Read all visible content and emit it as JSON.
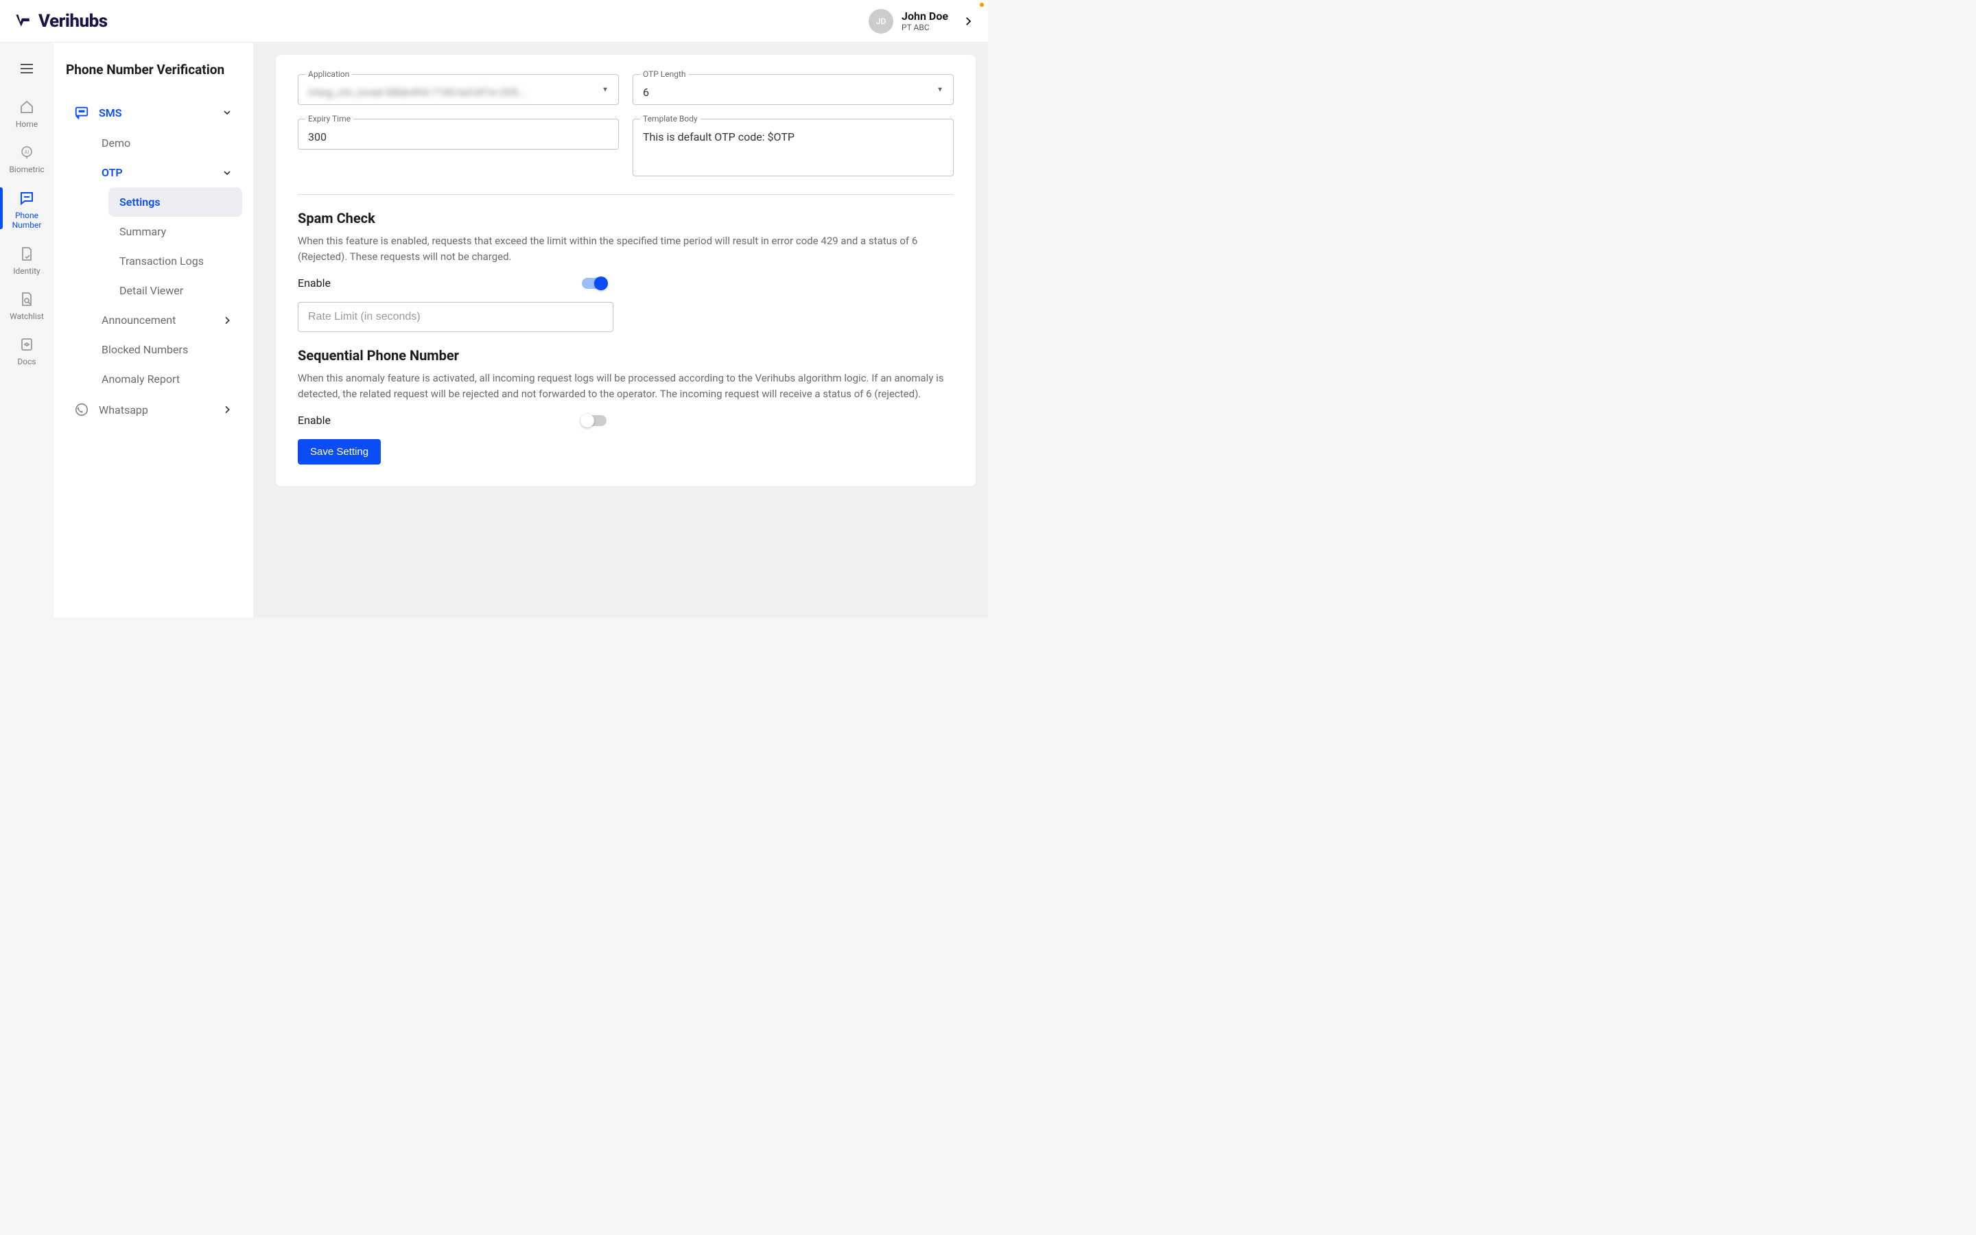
{
  "header": {
    "brand": "Verihubs",
    "user": {
      "initials": "JD",
      "name": "John Doe",
      "org": "PT ABC"
    }
  },
  "rail": {
    "items": [
      {
        "id": "home",
        "label": "Home"
      },
      {
        "id": "biometric",
        "label": "Biometric"
      },
      {
        "id": "phone-number",
        "label": "Phone Number"
      },
      {
        "id": "identity",
        "label": "Identity"
      },
      {
        "id": "watchlist",
        "label": "Watchlist"
      },
      {
        "id": "docs",
        "label": "Docs"
      }
    ]
  },
  "panel": {
    "title": "Phone Number Verification",
    "sms": {
      "label": "SMS",
      "demo": "Demo",
      "otp": {
        "label": "OTP",
        "items": [
          "Settings",
          "Summary",
          "Transaction Logs",
          "Detail Viewer"
        ]
      },
      "announcement": "Announcement",
      "blocked": "Blocked Numbers",
      "anomaly": "Anomaly Report"
    },
    "whatsapp": {
      "label": "Whatsapp"
    }
  },
  "form": {
    "application": {
      "label": "Application",
      "value": "integ_ctn_lorad-98bb494-7180-bd-bf1e-205..."
    },
    "otp_length": {
      "label": "OTP Length",
      "value": "6"
    },
    "expiry_time": {
      "label": "Expiry Time",
      "value": "300"
    },
    "template_body": {
      "label": "Template Body",
      "value": "This is default OTP code: $OTP"
    }
  },
  "spamcheck": {
    "title": "Spam Check",
    "desc": "When this feature is enabled, requests that exceed the limit within the specified time period will result in error code 429 and a status of 6 (Rejected). These requests will not be charged.",
    "enable_label": "Enable",
    "rate_limit_placeholder": "Rate Limit (in seconds)"
  },
  "sequential": {
    "title": "Sequential Phone Number",
    "desc": "When this anomaly feature is activated, all incoming request logs will be processed according to the Verihubs algorithm logic. If an anomaly is detected, the related request will be rejected and not forwarded to the operator. The incoming request will receive a status of 6 (rejected).",
    "enable_label": "Enable"
  },
  "actions": {
    "save": "Save Setting"
  },
  "colors": {
    "accent": "#0b4df5"
  }
}
